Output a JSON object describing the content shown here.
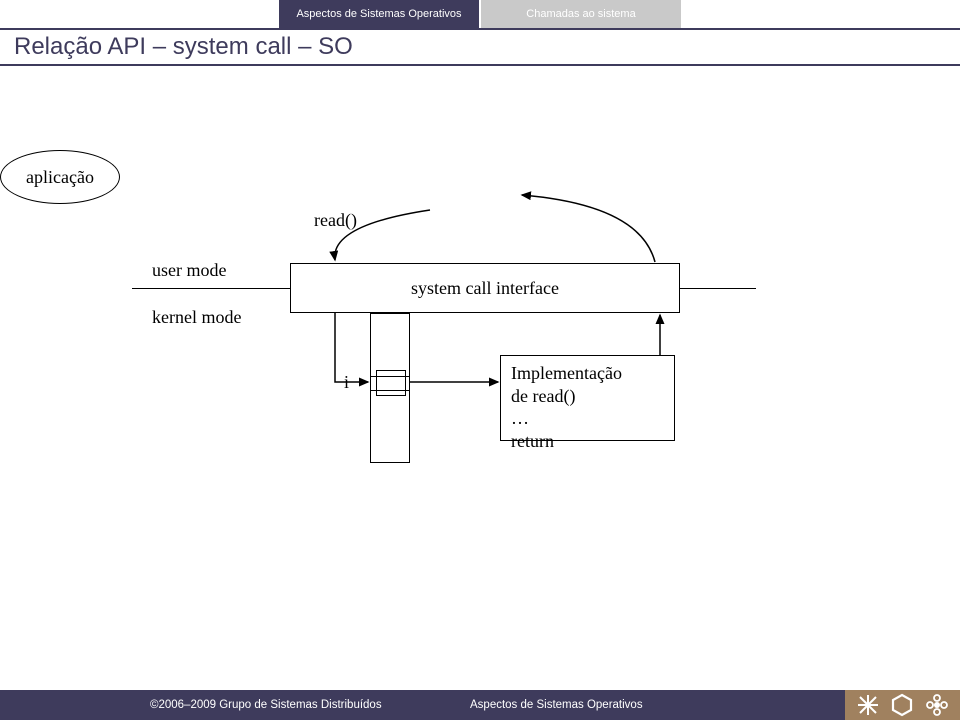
{
  "header": {
    "breadcrumb_left": "Aspectos de Sistemas Operativos",
    "breadcrumb_right": "Chamadas ao sistema",
    "title": "Relação API – system call – SO"
  },
  "diagram": {
    "read_label": "read()",
    "application_label": "aplicação",
    "user_mode_label": "user mode",
    "kernel_mode_label": "kernel mode",
    "sci_label": "system call interface",
    "index_label": "i",
    "impl_line1": "Implementação",
    "impl_line2": "de read()",
    "impl_line3": "…",
    "impl_line4": "return"
  },
  "footer": {
    "copyright": "©2006–2009 Grupo de Sistemas Distribuídos",
    "section": "Aspectos de Sistemas Operativos"
  }
}
